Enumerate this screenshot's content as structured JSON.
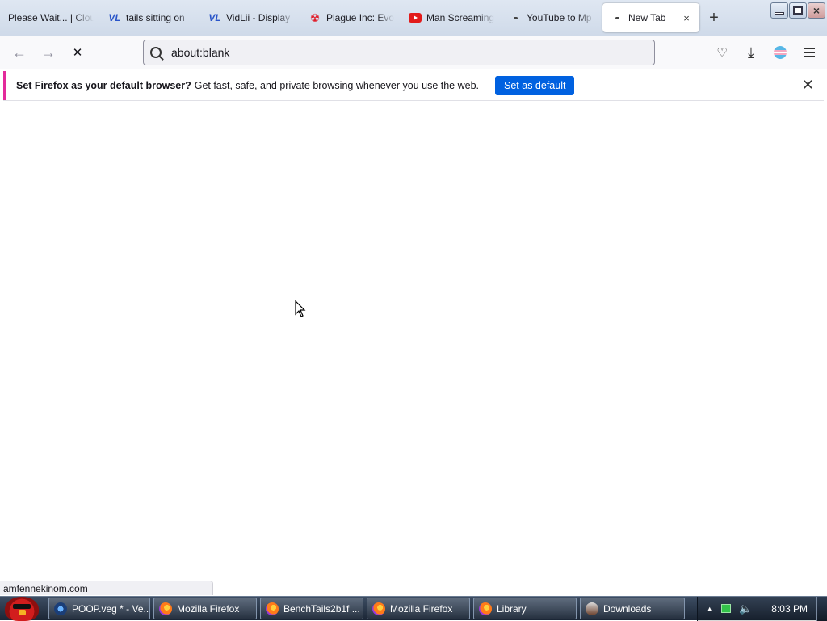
{
  "tabs": [
    {
      "title": "Please Wait... | Cloud",
      "icon": "none"
    },
    {
      "title": "tails sitting on",
      "icon": "vidlii-icon"
    },
    {
      "title": "VidLii - Display",
      "icon": "vidlii-icon"
    },
    {
      "title": "Plague Inc: Evo",
      "icon": "plague-icon"
    },
    {
      "title": "Man Screaming",
      "icon": "youtube-icon"
    },
    {
      "title": "YouTube to Mp",
      "icon": "dot-icon"
    },
    {
      "title": "New Tab",
      "icon": "dot-icon",
      "active": true
    }
  ],
  "vidlii_glyph": "VL",
  "plague_glyph": "☢",
  "new_tab_glyph": "+",
  "tab_close_glyph": "×",
  "url": {
    "value": "about:blank"
  },
  "nav": {
    "back": "←",
    "forward": "→",
    "stop": "✕"
  },
  "toolbar": {
    "pocket": "♡",
    "downloads": "⤓"
  },
  "notification": {
    "bold": "Set Firefox as your default browser?",
    "text": "Get fast, safe, and private browsing whenever you use the web.",
    "button": "Set as default",
    "close": "✕"
  },
  "status_text": "amfennekinom.com",
  "taskbar": {
    "items": [
      {
        "label": "POOP.veg * - Ve...",
        "icon": "vegas-icon",
        "width": 128
      },
      {
        "label": "Mozilla Firefox",
        "icon": "firefox-icon",
        "width": 128
      },
      {
        "label": "BenchTails2b1f ...",
        "icon": "firefox-icon",
        "width": 128
      },
      {
        "label": "Mozilla Firefox",
        "icon": "firefox-icon",
        "width": 128
      },
      {
        "label": "Library",
        "icon": "firefox-icon",
        "width": 128
      },
      {
        "label": "Downloads",
        "icon": "downloads-icon",
        "width": 130
      }
    ],
    "clock": "8:03 PM",
    "tray_up": "▲",
    "volume": "🔈"
  },
  "colors": {
    "accent": "#0061e0",
    "notif_stripe": "#e32a9b",
    "taskbar": "#1b2635"
  }
}
